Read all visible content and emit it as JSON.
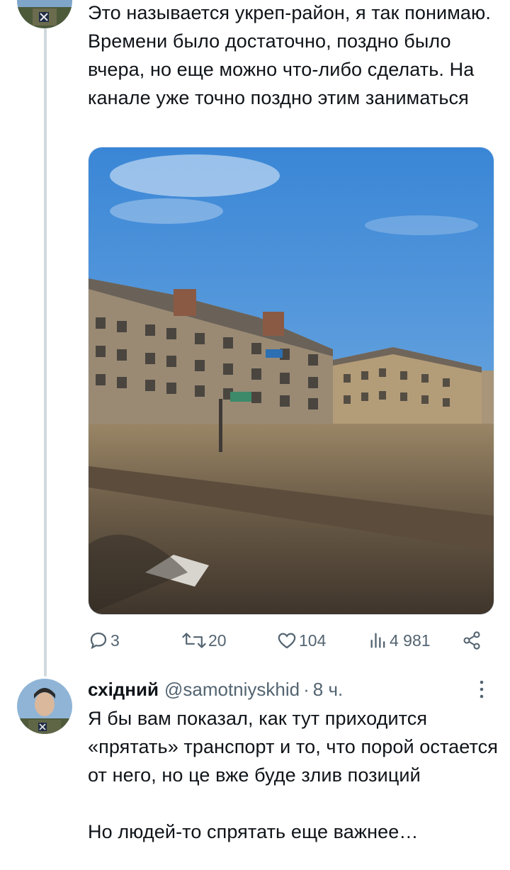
{
  "thread": {
    "prev_tweet": {
      "text": "Это называется укреп-район, я так понимаю. Времени было достаточно, поздно было вчера, но еще можно что-либо сделать. На канале уже точно поздно этим заниматься",
      "media": {
        "kind": "photo"
      },
      "actions": {
        "replies": "3",
        "retweets": "20",
        "likes": "104",
        "views": "4 981"
      }
    },
    "reply": {
      "author": "східний",
      "handle": "@samotniyskhid",
      "separator": "·",
      "time": "8 ч.",
      "text": "Я бы вам показал, как тут приходится «прятать» транспорт и то, что порой остается от него, но це вже буде злив позиций\n\nНо людей-то спрятать еще важнее…"
    }
  },
  "icons": {
    "reply": "reply-icon",
    "retweet": "retweet-icon",
    "like": "heart-icon",
    "views": "views-icon",
    "share": "share-icon",
    "more": "more-icon"
  },
  "colors": {
    "text": "#0f1419",
    "secondary": "#536471",
    "thread_line": "#cfd9de"
  }
}
